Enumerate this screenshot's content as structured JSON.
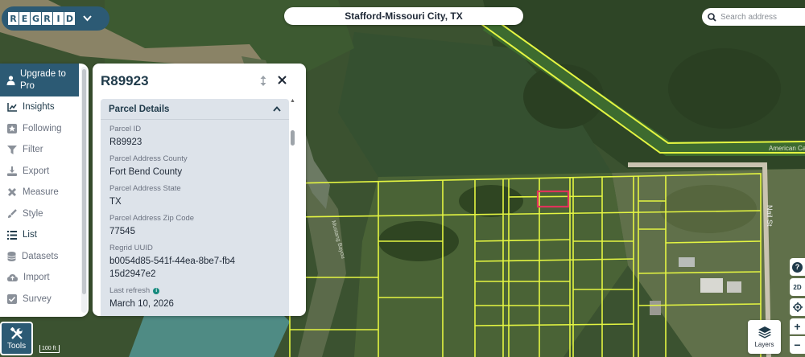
{
  "logo": {
    "letters": [
      "R",
      "E",
      "G",
      "R",
      "I",
      "D"
    ],
    "chevron_icon": "chevron-down-icon"
  },
  "location": {
    "title": "Stafford-Missouri City, TX"
  },
  "search": {
    "placeholder": "Search address",
    "icon": "search-icon"
  },
  "sidebar": {
    "upgrade_label": "Upgrade to Pro",
    "items": [
      {
        "label": "Insights",
        "icon": "chart-line-icon",
        "active": true
      },
      {
        "label": "Following",
        "icon": "star-icon",
        "active": false
      },
      {
        "label": "Filter",
        "icon": "funnel-icon",
        "active": false
      },
      {
        "label": "Export",
        "icon": "download-icon",
        "active": false
      },
      {
        "label": "Measure",
        "icon": "ruler-icon",
        "active": false
      },
      {
        "label": "Style",
        "icon": "brush-icon",
        "active": false
      },
      {
        "label": "List",
        "icon": "list-icon",
        "active": true
      },
      {
        "label": "Datasets",
        "icon": "database-icon",
        "active": false
      },
      {
        "label": "Import",
        "icon": "cloud-upload-icon",
        "active": false
      },
      {
        "label": "Survey",
        "icon": "checkbox-icon",
        "active": false
      }
    ]
  },
  "panel": {
    "title": "R89923",
    "section_title": "Parcel Details",
    "fields": [
      {
        "label": "Parcel ID",
        "value": "R89923"
      },
      {
        "label": "Parcel Address County",
        "value": "Fort Bend County"
      },
      {
        "label": "Parcel Address State",
        "value": "TX"
      },
      {
        "label": "Parcel Address Zip Code",
        "value": "77545"
      },
      {
        "label": "Regrid UUID",
        "value": "b0054d85-541f-44ea-8be7-fb415d2947e2"
      },
      {
        "label": "Last refresh",
        "value": "March 10, 2026",
        "info": true
      }
    ]
  },
  "map": {
    "street_labels": [
      "Nail St",
      "American Ca",
      "Mustang Bayou"
    ],
    "scale_label": "100 ft",
    "colors": {
      "parcel_line": "#e4f542",
      "selected_parcel": "#e0335a",
      "brand": "#2c5a74"
    }
  },
  "tools": {
    "label": "Tools"
  },
  "layers": {
    "label": "Layers"
  },
  "controls": {
    "help": "?",
    "view_mode": "2D",
    "zoom_in": "+",
    "zoom_out": "−"
  }
}
